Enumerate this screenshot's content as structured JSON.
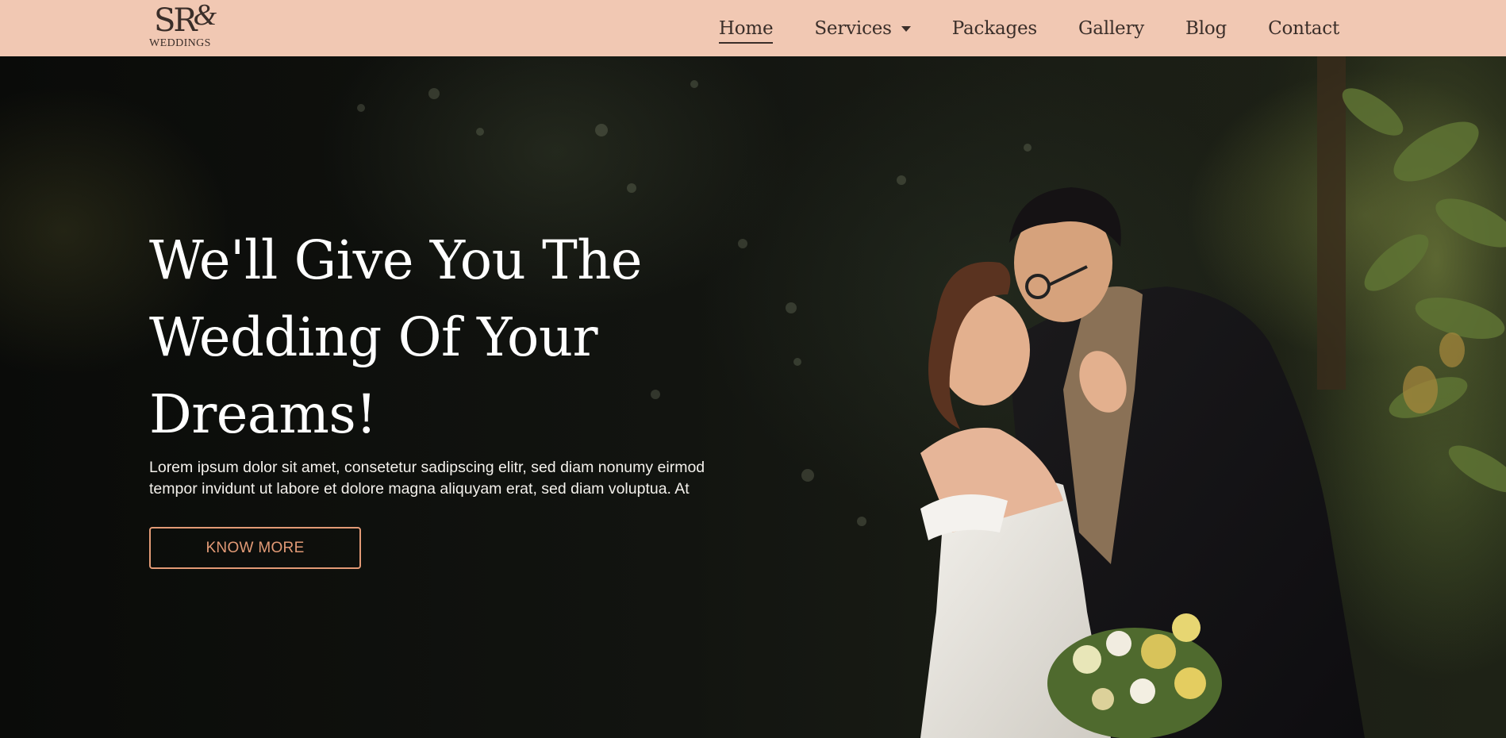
{
  "brand": {
    "logo_mark_letters": "SR",
    "logo_mark_amp": "&",
    "logo_sub": "WEDDINGS"
  },
  "nav": {
    "items": [
      {
        "label": "Home",
        "active": true
      },
      {
        "label": "Services",
        "has_dropdown": true
      },
      {
        "label": "Packages"
      },
      {
        "label": "Gallery"
      },
      {
        "label": "Blog"
      },
      {
        "label": "Contact"
      }
    ]
  },
  "hero": {
    "title": "We'll Give You The Wedding Of Your Dreams!",
    "description": "Lorem ipsum dolor sit amet, consetetur sadipscing elitr, sed diam nonumy eirmod tempor invidunt ut labore et dolore magna aliquyam erat, sed diam voluptua. At",
    "cta_label": "KNOW MORE",
    "image_subject": "wedding-couple-photo"
  },
  "colors": {
    "nav_background": "#f1c8b3",
    "nav_text": "#3a2e29",
    "accent": "#e29a76",
    "hero_text": "#ffffff"
  }
}
